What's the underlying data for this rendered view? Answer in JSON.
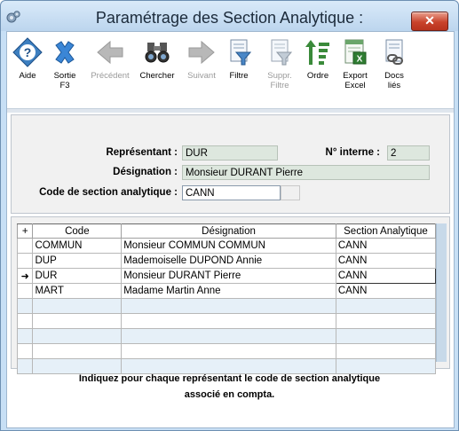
{
  "window": {
    "title": "Paramétrage des Section Analytique :",
    "close_label": "✕"
  },
  "toolbar": {
    "items": [
      {
        "label": "Aide",
        "icon": "help-icon",
        "enabled": true
      },
      {
        "label": "Sortie\nF3",
        "icon": "exit-icon",
        "enabled": true
      },
      {
        "label": "Précédent",
        "icon": "arrow-left-icon",
        "enabled": false
      },
      {
        "label": "Chercher",
        "icon": "binoculars-icon",
        "enabled": true
      },
      {
        "label": "Suivant",
        "icon": "arrow-right-icon",
        "enabled": false
      },
      {
        "label": "Filtre",
        "icon": "filter-icon",
        "enabled": true
      },
      {
        "label": "Suppr.\nFiltre",
        "icon": "remove-filter-icon",
        "enabled": false
      },
      {
        "label": "Ordre",
        "icon": "sort-icon",
        "enabled": true
      },
      {
        "label": "Export\nExcel",
        "icon": "excel-icon",
        "enabled": true
      },
      {
        "label": "Docs\nliés",
        "icon": "linked-docs-icon",
        "enabled": true
      }
    ]
  },
  "form": {
    "representant_label": "Représentant :",
    "representant_value": "DUR",
    "num_interne_label": "N° interne :",
    "num_interne_value": "2",
    "designation_label": "Désignation :",
    "designation_value": "Monsieur DURANT Pierre",
    "code_section_label": "Code de section analytique :",
    "code_section_value": "CANN"
  },
  "grid": {
    "columns": [
      "Code",
      "Désignation",
      "Section Analytique"
    ],
    "rows": [
      {
        "code": "COMMUN",
        "designation": "Monsieur COMMUN COMMUN",
        "section": "CANN"
      },
      {
        "code": "DUP",
        "designation": "Mademoiselle DUPOND Annie",
        "section": "CANN"
      },
      {
        "code": "DUR",
        "designation": "Monsieur DURANT Pierre",
        "section": "CANN"
      },
      {
        "code": "MART",
        "designation": "Madame Martin Anne",
        "section": "CANN"
      }
    ],
    "current_row_marker": "➜"
  },
  "hint": {
    "line1": "Indiquez pour chaque représentant le code de section analytique",
    "line2": "associé en compta."
  }
}
